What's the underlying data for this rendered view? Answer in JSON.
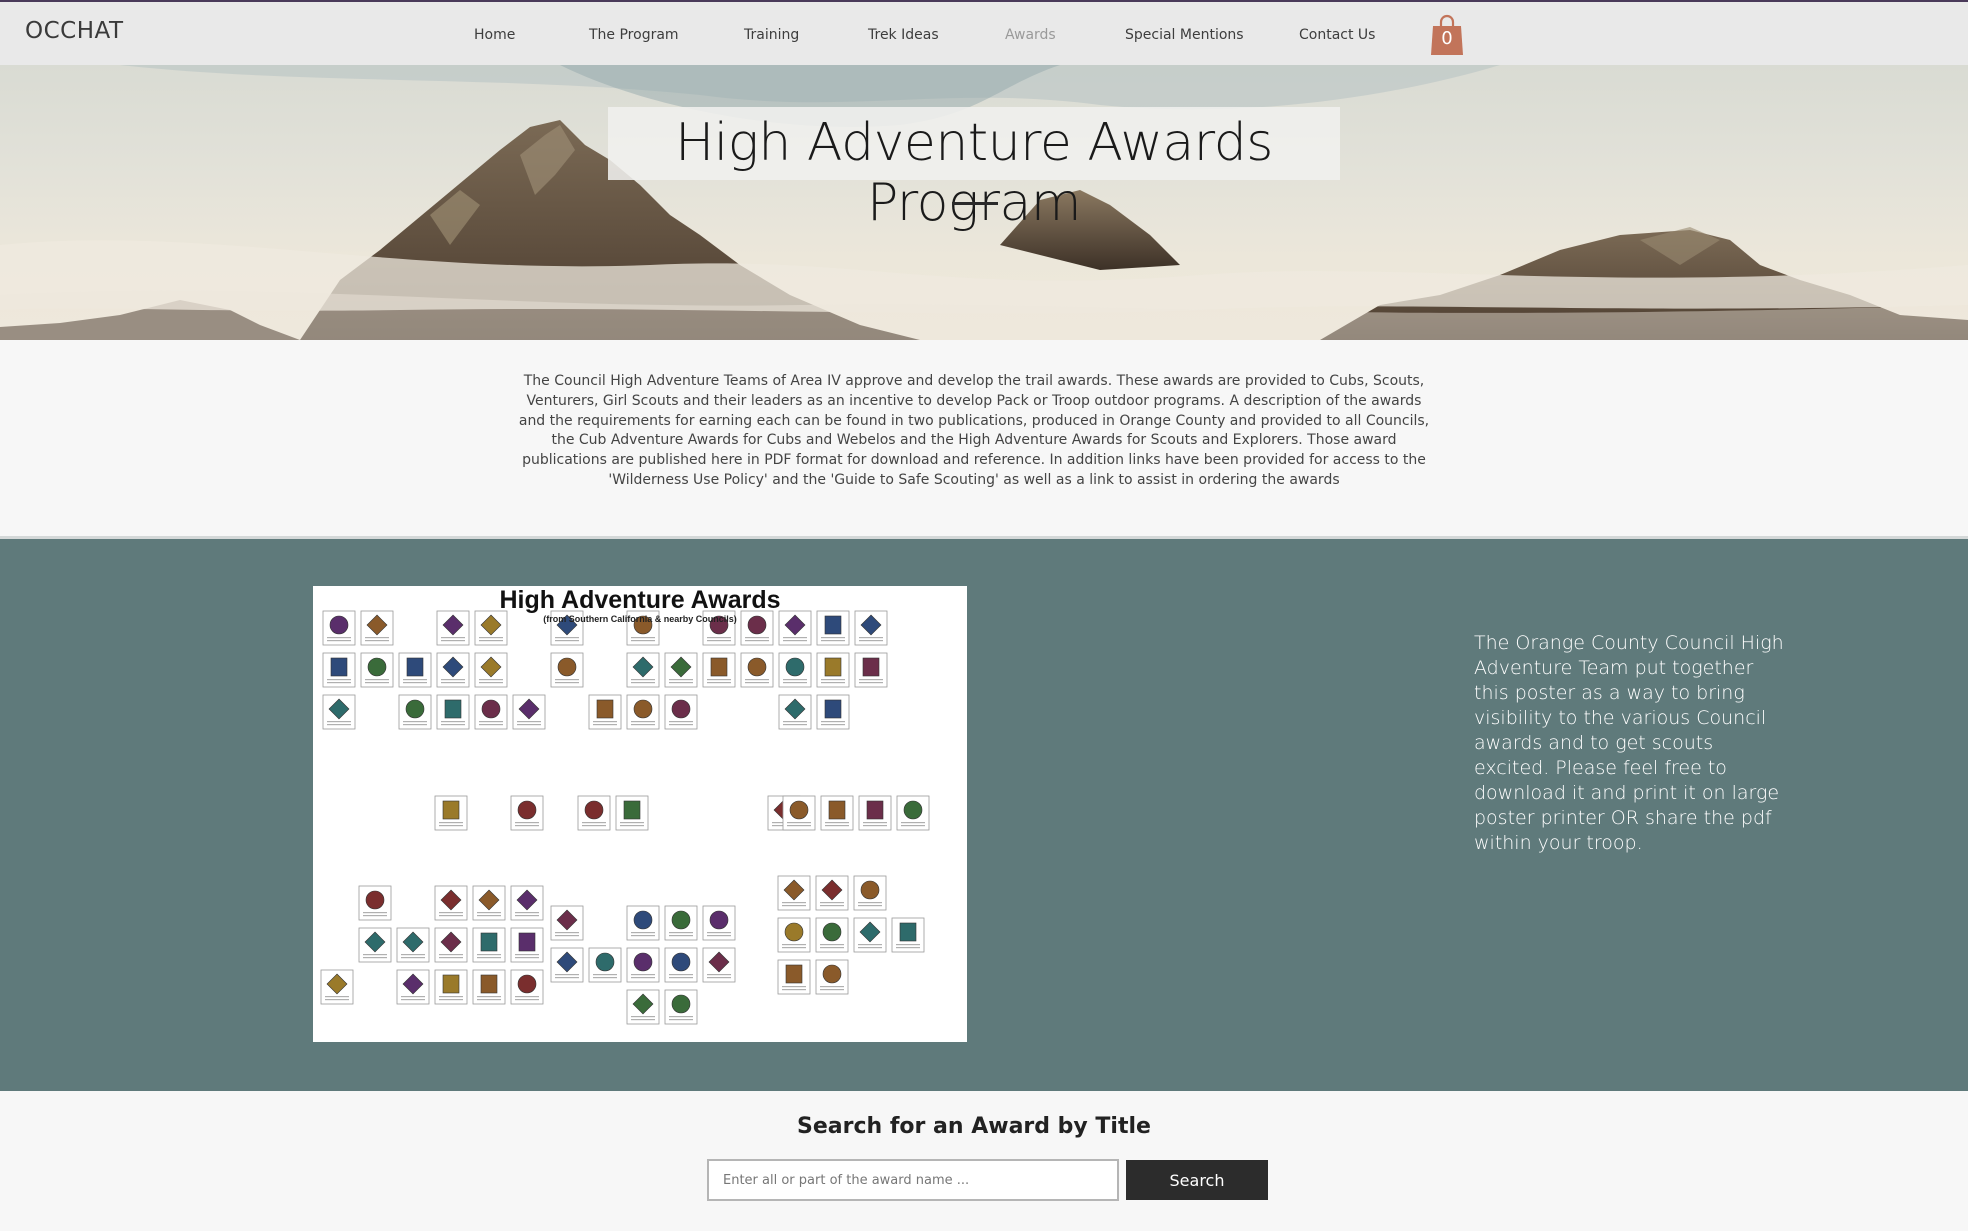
{
  "site": {
    "logo": "OCCHAT"
  },
  "nav": {
    "items": [
      {
        "label": "Home",
        "active": false
      },
      {
        "label": "The Program",
        "active": false
      },
      {
        "label": "Training",
        "active": false
      },
      {
        "label": "Trek Ideas",
        "active": false
      },
      {
        "label": "Awards",
        "active": true
      },
      {
        "label": "Special Mentions",
        "active": false
      },
      {
        "label": "Contact Us",
        "active": false
      }
    ],
    "cart": {
      "count": "0",
      "icon": "shopping-bag-icon",
      "color": "#c2745a"
    }
  },
  "hero": {
    "title": "High Adventure Awards Program"
  },
  "intro": {
    "text": "The Council High Adventure Teams of Area IV approve and develop the trail awards. These awards are provided to Cubs, Scouts, Venturers, Girl Scouts and their leaders as an incentive to develop Pack or Troop outdoor programs. A description of the awards and the requirements for earning each can be found in two publications, produced in Orange County and provided to all Councils, the Cub Adventure Awards for Cubs and Webelos and the High Adventure Awards for Scouts and Explorers. Those award publications are published here in PDF format for download and reference. In addition links have been provided for access to the 'Wilderness Use Policy' and the 'Guide to Safe Scouting' as well as a link to assist in ordering the awards"
  },
  "poster": {
    "title": "High Adventure Awards",
    "subtitle": "(from Southern California & nearby Councils)",
    "band_color": "#5f7a7b"
  },
  "poster_description": {
    "text": "The Orange County Council High Adventure Team put together this poster as a way to bring visibility to the various Council awards and to get scouts excited.  Please feel free to download it and print it on large poster printer OR share the pdf within your troop."
  },
  "search": {
    "title": "Search for an Award by Title",
    "placeholder": "Enter all or part of the award name ...",
    "button_label": "Search"
  }
}
